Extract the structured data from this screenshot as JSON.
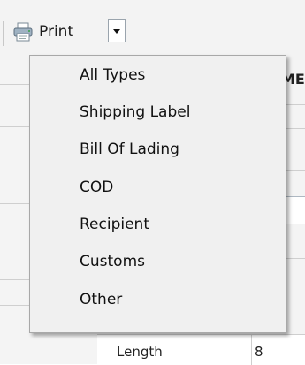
{
  "toolbar": {
    "print_label": "Print",
    "print_icon": "printer-icon"
  },
  "background": {
    "header_partial": "ME",
    "length_label": "Length",
    "length_value": "8"
  },
  "dropdown": {
    "items": [
      "All Types",
      "Shipping Label",
      "Bill Of Lading",
      "COD",
      "Recipient",
      "Customs",
      "Other"
    ]
  }
}
